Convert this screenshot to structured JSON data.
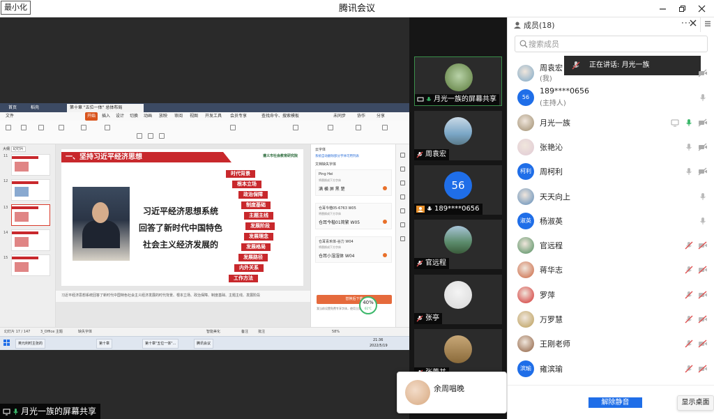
{
  "window": {
    "title": "腾讯会议",
    "minimize_label": "最小化"
  },
  "share": {
    "sharer_label": "月光一族的屏幕共享",
    "wps": {
      "tabs": [
        "首页",
        "稻壳",
        "第十章 \"五位一体\" 总体布局"
      ],
      "menu": [
        "文件",
        "开始",
        "插入",
        "设计",
        "切换",
        "动画",
        "放映",
        "审阅",
        "视图",
        "开发工具",
        "会员专享",
        "查找命令、搜索模板",
        "未同步",
        "协作",
        "分享"
      ],
      "thumbs_header": [
        "大纲",
        "幻灯片"
      ],
      "thumb_numbers": [
        "11",
        "12",
        "13",
        "14",
        "15"
      ],
      "slide": {
        "heading": "一、坚持习近平经济思想",
        "logo_text": "遵义市社会教育研究院",
        "lines": [
          "习近平经济思想系统",
          "回答了新时代中国特色",
          "社会主义经济发展的"
        ],
        "keywords": [
          "时代背景",
          "根本立场",
          "政治保障",
          "制度基础",
          "主题主线",
          "发展阶段",
          "发展理念",
          "发展格局",
          "发展路径",
          "内外关系",
          "工作方法"
        ]
      },
      "notes_text": "习近平经济思想系统回答了新时代中国特色社会主义经济发展的时代背景、根本立场、政治保障、制度基础、主题主线、发展阶段",
      "font_pane": {
        "header": "云字体",
        "link": "系统自动删除部分字体可用列表",
        "sub": "文档缺失字体",
        "fonts": [
          {
            "name": "Ping Hei",
            "hint": "将替换成下方字体",
            "replace": "满 横 屏 黑 楚"
          },
          {
            "name": "仓耳今楷05-6763 W05",
            "hint": "将替换成下方字体",
            "replace": "仓耳今楷01简繁 W05"
          },
          {
            "name": "仓耳青禾体-谷力 W04",
            "hint": "将替换成下方字体",
            "replace": "仓耳小湿湿体 W04"
          }
        ],
        "download": "替换后下载",
        "check": "我当前设置免费专享字体，使用立即下载",
        "percent": "40%",
        "temp": "61°C"
      },
      "status": [
        "幻灯片 17 / 147",
        "3_Office 主题",
        "缺失字体",
        "智能美化",
        "备注",
        "批注",
        "58%"
      ],
      "taskbar": [
        "英元利时主张的",
        "第十章",
        "第十章\"五位一体\"...",
        "腾讯会议"
      ],
      "clock": {
        "time": "21:36",
        "date": "2022/5/19"
      }
    }
  },
  "tiles": [
    {
      "name": "月光一族的屏幕共享",
      "kind": "share"
    },
    {
      "name": "周袁宏",
      "kind": "muted"
    },
    {
      "name": "189****0656",
      "kind": "mic",
      "avatar_text": "56"
    },
    {
      "name": "官远程",
      "kind": "muted"
    },
    {
      "name": "张亭",
      "kind": "muted"
    },
    {
      "name": "张蕾并",
      "kind": "muted"
    }
  ],
  "popup": {
    "name": "余周唱晚"
  },
  "members": {
    "title": "成员(18)",
    "search_placeholder": "搜索成员",
    "speaking_prefix": "正在讲话:",
    "speaking_name": "月光一族",
    "unmute_label": "解除静音",
    "show_desktop_label": "显示桌面",
    "list": [
      {
        "name": "周袁宏",
        "sub": "(我)",
        "avatar": "photo",
        "color": "#7ba7c7",
        "icons": [
          "video-off"
        ]
      },
      {
        "name": "189****0656",
        "sub": "(主持人)",
        "avatar": "text",
        "avatar_text": "56",
        "icons": [
          "mic"
        ]
      },
      {
        "name": "月光一族",
        "avatar": "photo",
        "color": "#9c8a6b",
        "icons": [
          "screen",
          "mic-active",
          "video-off"
        ]
      },
      {
        "name": "张艳沁",
        "avatar": "photo",
        "color": "#e0c9d5",
        "icons": [
          "mic",
          "video-off"
        ]
      },
      {
        "name": "周柯利",
        "avatar": "text",
        "avatar_text": "柯利",
        "icons": [
          "mic",
          "video-off"
        ]
      },
      {
        "name": "天天向上",
        "avatar": "photo",
        "color": "#5a89b8",
        "icons": [
          "mic"
        ]
      },
      {
        "name": "杨淑英",
        "avatar": "text",
        "avatar_text": "淑英",
        "icons": [
          "mic"
        ]
      },
      {
        "name": "官远程",
        "avatar": "photo",
        "color": "#4a8a5a",
        "icons": [
          "mic-muted",
          "video-muted"
        ]
      },
      {
        "name": "蒋华志",
        "avatar": "photo",
        "color": "#c9603a",
        "icons": [
          "mic-muted",
          "video-muted"
        ]
      },
      {
        "name": "罗萍",
        "avatar": "photo",
        "color": "#d12a2a",
        "icons": [
          "mic-muted",
          "video-muted"
        ]
      },
      {
        "name": "万罗慧",
        "avatar": "photo",
        "color": "#b89a52",
        "icons": [
          "mic-muted",
          "video-muted"
        ]
      },
      {
        "name": "王刚老师",
        "avatar": "photo",
        "color": "#8a5a3a",
        "icons": [
          "mic-muted",
          "video-muted"
        ]
      },
      {
        "name": "雍滨瑜",
        "avatar": "text",
        "avatar_text": "滨瑜",
        "icons": [
          "mic-muted",
          "video-muted"
        ]
      }
    ]
  },
  "colors": {
    "accent": "#1f6ee8",
    "muted_red": "#e05050",
    "active_green": "#3cb86b"
  }
}
